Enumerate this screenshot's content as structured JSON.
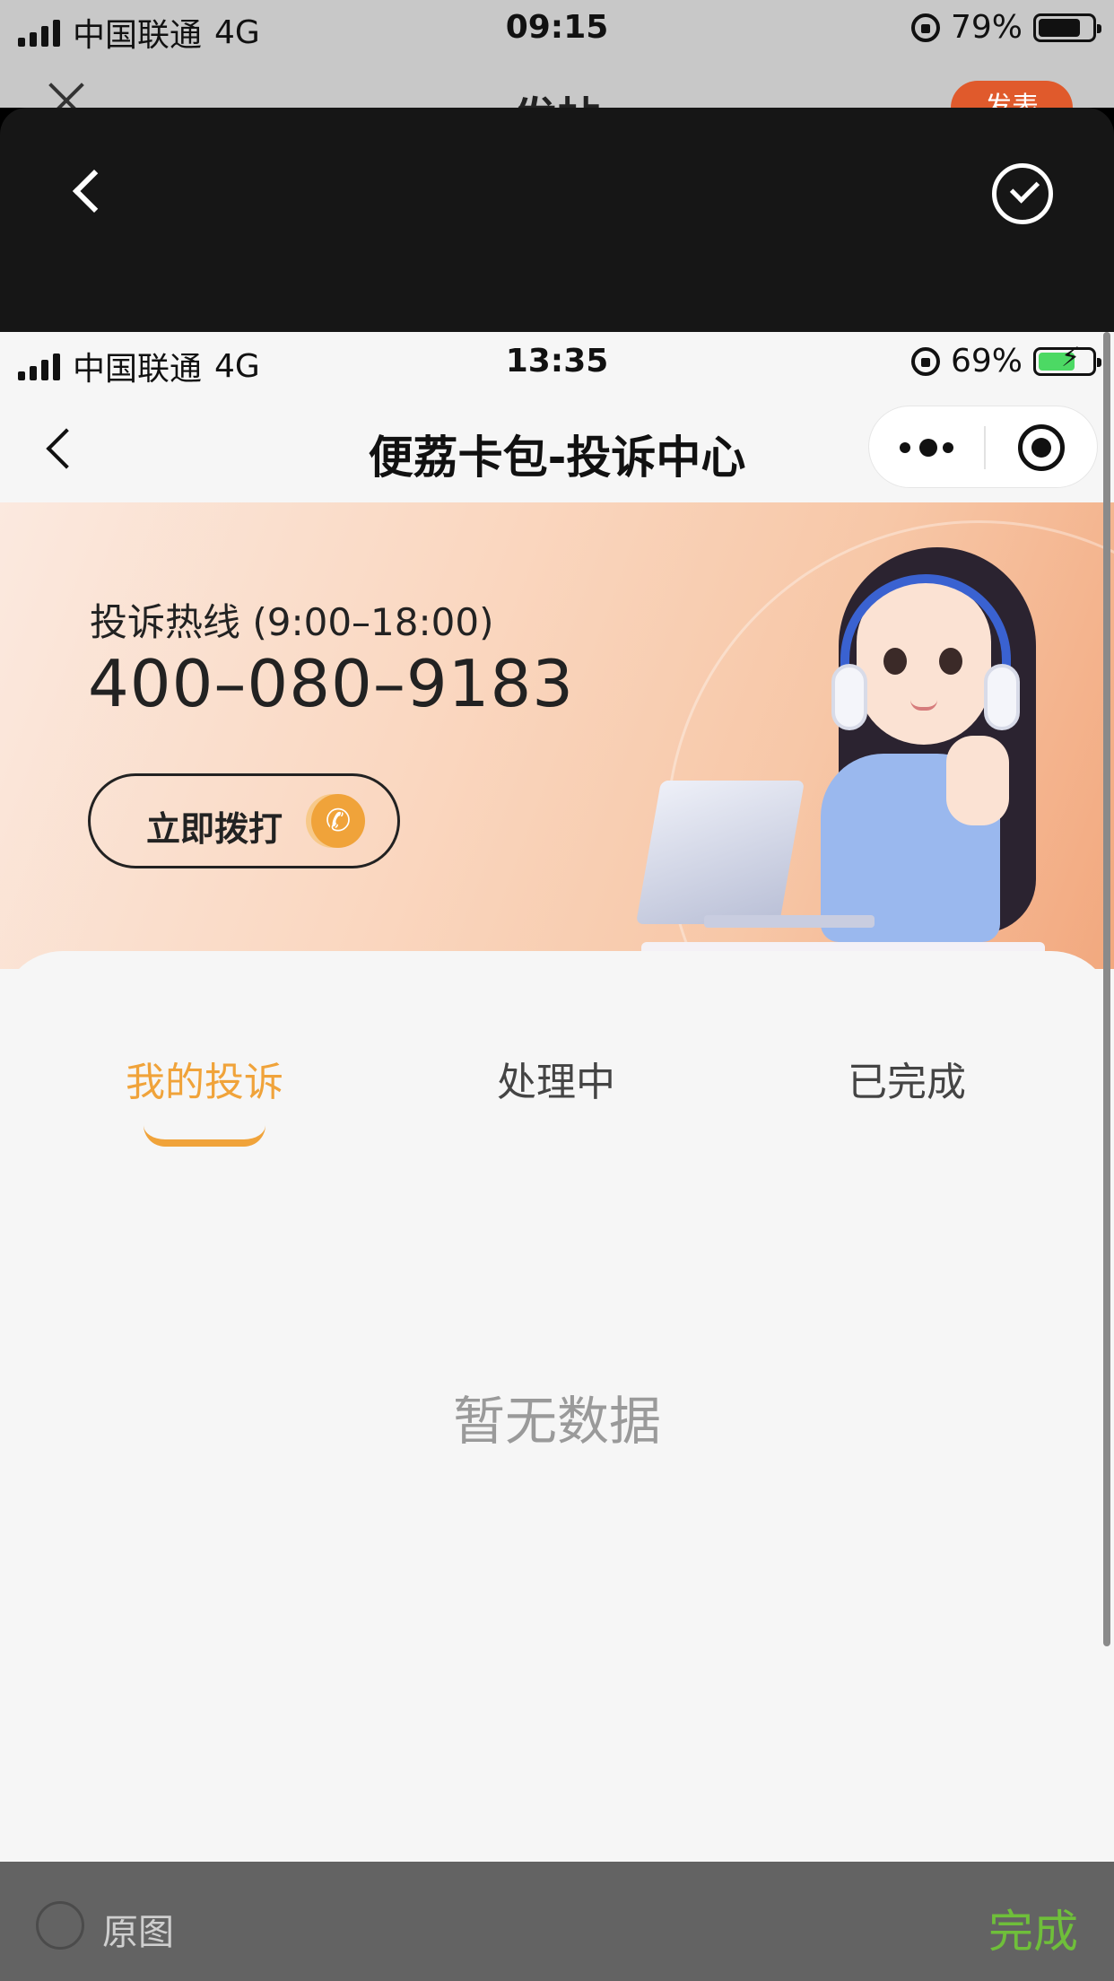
{
  "outer_status": {
    "carrier": "中国联通",
    "network": "4G",
    "time": "09:15",
    "battery": "79%",
    "battery_level": 0.79
  },
  "outer_peek": {
    "title": "发帖",
    "publish_label": "发表"
  },
  "editor": {
    "back_icon": "chevron-left-icon",
    "confirm_icon": "check-circle-icon"
  },
  "inner_status": {
    "carrier": "中国联通",
    "network": "4G",
    "time": "13:35",
    "battery": "69%",
    "battery_level": 0.69,
    "charging": true
  },
  "navbar": {
    "title": "便荔卡包-投诉中心",
    "more_icon": "more-dots-icon",
    "close_icon": "target-icon"
  },
  "hero": {
    "hotline_label": "投诉热线 (9:00–18:00)",
    "hotline_number": "400–080–9183",
    "call_label": "立即拨打",
    "phone_icon": "phone-icon"
  },
  "tabs": [
    {
      "label": "我的投诉",
      "active": true
    },
    {
      "label": "处理中",
      "active": false
    },
    {
      "label": "已完成",
      "active": false
    }
  ],
  "empty_text": "暂无数据",
  "bottom_bar": {
    "original_label": "原图",
    "done_label": "完成"
  },
  "colors": {
    "accent": "#f0a33a",
    "done_green": "#6fbf3a",
    "publish_red": "#e05a2c"
  }
}
